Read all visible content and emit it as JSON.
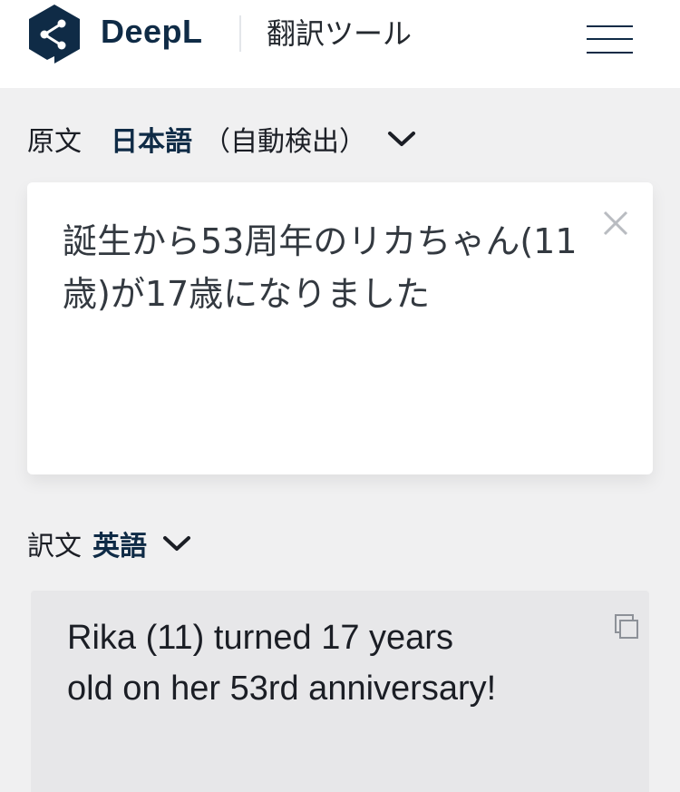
{
  "header": {
    "brand": "DeepL",
    "product_title": "翻訳ツール",
    "menu_icon": "hamburger-menu-icon",
    "brand_color": "#0f2b46"
  },
  "source": {
    "label": "原文",
    "language": "日本語",
    "auto_detect": "（自動検出）",
    "text": "誕生から53周年のリカちゃん(11歳)が17歳になりました",
    "clear_icon": "close-icon"
  },
  "target": {
    "label": "訳文",
    "language": "英語",
    "text": "Rika (11) turned 17 years old on her 53rd anniversary!",
    "copy_icon": "copy-icon"
  }
}
